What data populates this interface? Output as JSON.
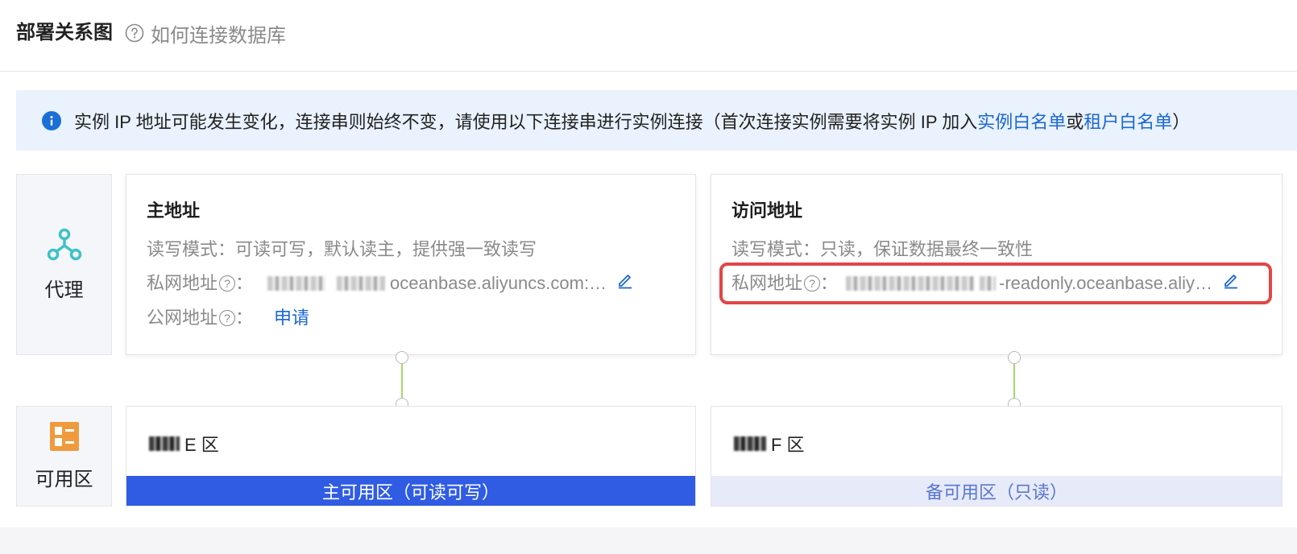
{
  "header": {
    "title": "部署关系图",
    "help_link": "如何连接数据库"
  },
  "alert": {
    "text": "实例 IP 地址可能发生变化，连接串则始终不变，请使用以下连接串进行实例连接（首次连接实例需要将实例 IP 加入",
    "link1": "实例白名单",
    "or": "或",
    "link2": "租户白名单",
    "close_paren": "）"
  },
  "proxy": {
    "label": "代理",
    "icon": "network-nodes-icon",
    "icon_color": "#3ec1c8"
  },
  "zone_section": {
    "label": "可用区",
    "icon": "zone-grid-icon",
    "icon_color": "#f09a3e"
  },
  "primary_address": {
    "title": "主地址",
    "mode_label": "读写模式：",
    "mode_value": "可读可写，默认读主，提供强一致读写",
    "private_label": "私网地址",
    "private_value": "oceanbase.aliyuncs.com:…",
    "public_label": "公网地址",
    "colon": "：",
    "apply": "申请"
  },
  "access_address": {
    "title": "访问地址",
    "mode_label": "读写模式：",
    "mode_value": "只读，保证数据最终一致性",
    "private_label": "私网地址",
    "private_value": "-readonly.oceanbase.aliy…",
    "colon": "："
  },
  "zones": [
    {
      "name": "E 区",
      "role": "主可用区（可读可写）",
      "role_color": "#2f5ce3"
    },
    {
      "name": "F 区",
      "role": "备可用区（只读）",
      "role_color": "#e7eaf9"
    }
  ],
  "colors": {
    "link": "#1b66d2",
    "highlight": "#e24646",
    "connector": "#a7d96a"
  }
}
